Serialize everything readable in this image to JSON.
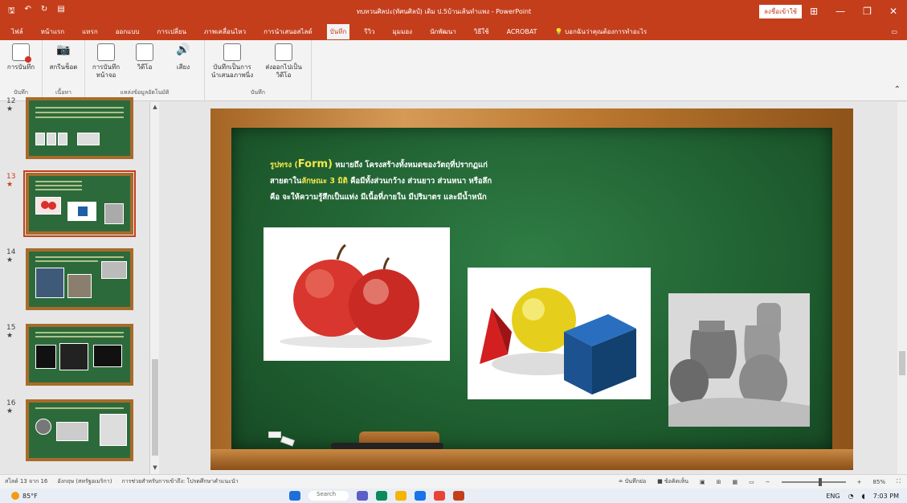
{
  "window": {
    "title": "ทบทวนศิลปะ(ทัศนศิลป์) เติม ป.5บ้านเส้นทำแพง - PowerPoint",
    "signin_label": "ลงชื่อเข้าใช้"
  },
  "tabs": [
    "ไฟล์",
    "หน้าแรก",
    "แทรก",
    "ออกแบบ",
    "การเปลี่ยน",
    "ภาพเคลื่อนไหว",
    "การนำเสนอสไลด์",
    "บันทึก",
    "รีวิว",
    "มุมมอง",
    "นักพัฒนา",
    "วิธีใช้",
    "ACROBAT"
  ],
  "active_tab": "บันทึก",
  "tell_me": "บอกฉันว่าคุณต้องการทำอะไร",
  "ribbon": {
    "groups": [
      {
        "label": "บันทึก",
        "buttons": [
          "การบันทึก"
        ]
      },
      {
        "label": "เนื้อหา",
        "buttons": [
          "สกรีนช็อต"
        ]
      },
      {
        "label": "แหล่งข้อมูลอัตโนมัติ",
        "buttons": [
          "การบันทึกหน้าจอ",
          "วิดีโอ",
          "เสียง"
        ]
      },
      {
        "label": "บันทึก",
        "buttons": [
          "บันทึกเป็นการนำเสนอภาพนิ่ง",
          "ส่งออกไปเป็นวิดีโอ"
        ]
      }
    ]
  },
  "thumbnails": [
    {
      "num": "12",
      "star": "★"
    },
    {
      "num": "13",
      "star": "★",
      "active": true
    },
    {
      "num": "14",
      "star": "★"
    },
    {
      "num": "15",
      "star": "★"
    },
    {
      "num": "16",
      "star": "★"
    }
  ],
  "slide": {
    "line1_pre": "รูปทรง (",
    "line1_form": "Form)",
    "line1_post": " หมายถึง โครงสร้างทั้งหมดของวัตถุที่ปรากฏแก่",
    "line2_pre": "สายตาใน",
    "line2_hl": "ลักษณะ 3 มิติ",
    "line2_post": " คือมีทั้งส่วนกว้าง ส่วนยาว ส่วนหนา หรือลึก",
    "line3": "คือ จะให้ความรู้สึกเป็นแท่ง มีเนื้อที่ภายใน มีปริมาตร และมีน้ำหนัก"
  },
  "status": {
    "slide_count": "สไลด์ 13 จาก 16",
    "language": "อังกฤษ (สหรัฐอเมริกา)",
    "accessibility": "การช่วยสำหรับการเข้าถึง: โปรดศึกษาคำแนะนำ",
    "notes": "บันทึกย่อ",
    "comments": "ข้อคิดเห็น",
    "zoom": "85%"
  },
  "taskbar": {
    "temp": "85°F",
    "search": "Search",
    "lang": "ENG",
    "time": "7:03 PM"
  },
  "colors": {
    "accent": "#c43e1c",
    "board": "#2d6a3b",
    "frame": "#b9772f",
    "highlight": "#f3e84b"
  }
}
